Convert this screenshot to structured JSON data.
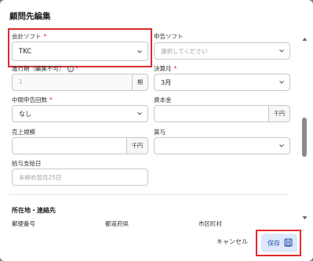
{
  "dialog": {
    "title": "顧問先編集"
  },
  "fields": {
    "accounting_software": {
      "label": "会計ソフト",
      "required": "*",
      "value": "TKC"
    },
    "tax_software": {
      "label": "申告ソフト",
      "placeholder": "選択してください"
    },
    "fiscal_period": {
      "label": "進行期（編集不可）",
      "required": "*",
      "placeholder": "1",
      "unit": "期"
    },
    "closing_month": {
      "label": "決算月",
      "required": "*",
      "value": "3月"
    },
    "interim_filings": {
      "label": "中間申告回数",
      "required": "*",
      "value": "なし"
    },
    "capital": {
      "label": "資本金",
      "unit": "千円"
    },
    "sales_scale": {
      "label": "売上規模",
      "unit": "千円"
    },
    "bonus": {
      "label": "賞与"
    },
    "payday": {
      "label": "給与支給日",
      "placeholder": "末締め翌月25日"
    }
  },
  "section": {
    "title": "所在地・連絡先"
  },
  "address": {
    "postal_label": "郵便番号",
    "prefecture_label": "都道府県",
    "city_label": "市区町村"
  },
  "footer": {
    "cancel_label": "キャンセル",
    "save_label": "保存"
  },
  "icons": {
    "info": "info-icon",
    "chevron": "chevron-down-icon",
    "save": "floppy-disk-icon"
  },
  "colors": {
    "highlight": "#e02b2b",
    "save_bg": "#dde8fb",
    "save_text": "#1e4fa8"
  }
}
